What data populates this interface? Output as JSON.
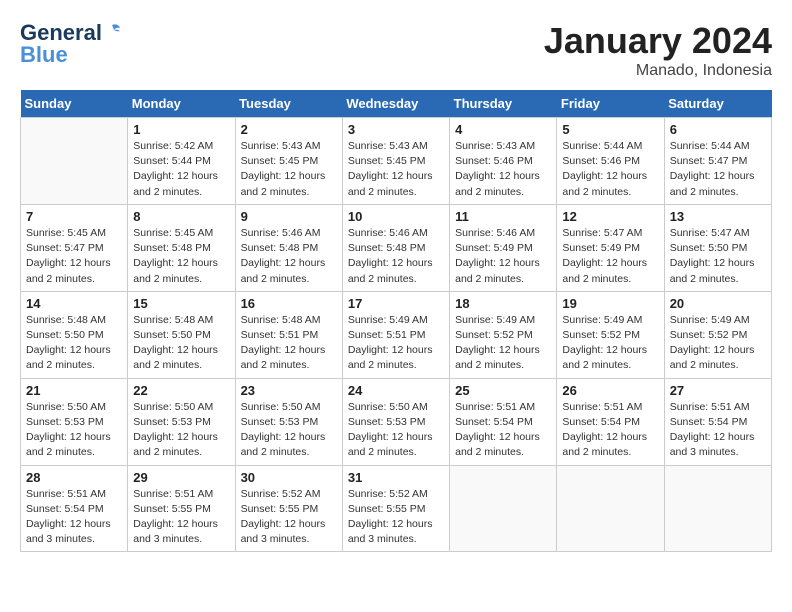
{
  "header": {
    "logo_line1": "General",
    "logo_line2": "Blue",
    "title": "January 2024",
    "subtitle": "Manado, Indonesia"
  },
  "days_of_week": [
    "Sunday",
    "Monday",
    "Tuesday",
    "Wednesday",
    "Thursday",
    "Friday",
    "Saturday"
  ],
  "weeks": [
    [
      {
        "num": "",
        "info": ""
      },
      {
        "num": "1",
        "info": "Sunrise: 5:42 AM\nSunset: 5:44 PM\nDaylight: 12 hours\nand 2 minutes."
      },
      {
        "num": "2",
        "info": "Sunrise: 5:43 AM\nSunset: 5:45 PM\nDaylight: 12 hours\nand 2 minutes."
      },
      {
        "num": "3",
        "info": "Sunrise: 5:43 AM\nSunset: 5:45 PM\nDaylight: 12 hours\nand 2 minutes."
      },
      {
        "num": "4",
        "info": "Sunrise: 5:43 AM\nSunset: 5:46 PM\nDaylight: 12 hours\nand 2 minutes."
      },
      {
        "num": "5",
        "info": "Sunrise: 5:44 AM\nSunset: 5:46 PM\nDaylight: 12 hours\nand 2 minutes."
      },
      {
        "num": "6",
        "info": "Sunrise: 5:44 AM\nSunset: 5:47 PM\nDaylight: 12 hours\nand 2 minutes."
      }
    ],
    [
      {
        "num": "7",
        "info": "Sunrise: 5:45 AM\nSunset: 5:47 PM\nDaylight: 12 hours\nand 2 minutes."
      },
      {
        "num": "8",
        "info": "Sunrise: 5:45 AM\nSunset: 5:48 PM\nDaylight: 12 hours\nand 2 minutes."
      },
      {
        "num": "9",
        "info": "Sunrise: 5:46 AM\nSunset: 5:48 PM\nDaylight: 12 hours\nand 2 minutes."
      },
      {
        "num": "10",
        "info": "Sunrise: 5:46 AM\nSunset: 5:48 PM\nDaylight: 12 hours\nand 2 minutes."
      },
      {
        "num": "11",
        "info": "Sunrise: 5:46 AM\nSunset: 5:49 PM\nDaylight: 12 hours\nand 2 minutes."
      },
      {
        "num": "12",
        "info": "Sunrise: 5:47 AM\nSunset: 5:49 PM\nDaylight: 12 hours\nand 2 minutes."
      },
      {
        "num": "13",
        "info": "Sunrise: 5:47 AM\nSunset: 5:50 PM\nDaylight: 12 hours\nand 2 minutes."
      }
    ],
    [
      {
        "num": "14",
        "info": "Sunrise: 5:48 AM\nSunset: 5:50 PM\nDaylight: 12 hours\nand 2 minutes."
      },
      {
        "num": "15",
        "info": "Sunrise: 5:48 AM\nSunset: 5:50 PM\nDaylight: 12 hours\nand 2 minutes."
      },
      {
        "num": "16",
        "info": "Sunrise: 5:48 AM\nSunset: 5:51 PM\nDaylight: 12 hours\nand 2 minutes."
      },
      {
        "num": "17",
        "info": "Sunrise: 5:49 AM\nSunset: 5:51 PM\nDaylight: 12 hours\nand 2 minutes."
      },
      {
        "num": "18",
        "info": "Sunrise: 5:49 AM\nSunset: 5:52 PM\nDaylight: 12 hours\nand 2 minutes."
      },
      {
        "num": "19",
        "info": "Sunrise: 5:49 AM\nSunset: 5:52 PM\nDaylight: 12 hours\nand 2 minutes."
      },
      {
        "num": "20",
        "info": "Sunrise: 5:49 AM\nSunset: 5:52 PM\nDaylight: 12 hours\nand 2 minutes."
      }
    ],
    [
      {
        "num": "21",
        "info": "Sunrise: 5:50 AM\nSunset: 5:53 PM\nDaylight: 12 hours\nand 2 minutes."
      },
      {
        "num": "22",
        "info": "Sunrise: 5:50 AM\nSunset: 5:53 PM\nDaylight: 12 hours\nand 2 minutes."
      },
      {
        "num": "23",
        "info": "Sunrise: 5:50 AM\nSunset: 5:53 PM\nDaylight: 12 hours\nand 2 minutes."
      },
      {
        "num": "24",
        "info": "Sunrise: 5:50 AM\nSunset: 5:53 PM\nDaylight: 12 hours\nand 2 minutes."
      },
      {
        "num": "25",
        "info": "Sunrise: 5:51 AM\nSunset: 5:54 PM\nDaylight: 12 hours\nand 2 minutes."
      },
      {
        "num": "26",
        "info": "Sunrise: 5:51 AM\nSunset: 5:54 PM\nDaylight: 12 hours\nand 2 minutes."
      },
      {
        "num": "27",
        "info": "Sunrise: 5:51 AM\nSunset: 5:54 PM\nDaylight: 12 hours\nand 3 minutes."
      }
    ],
    [
      {
        "num": "28",
        "info": "Sunrise: 5:51 AM\nSunset: 5:54 PM\nDaylight: 12 hours\nand 3 minutes."
      },
      {
        "num": "29",
        "info": "Sunrise: 5:51 AM\nSunset: 5:55 PM\nDaylight: 12 hours\nand 3 minutes."
      },
      {
        "num": "30",
        "info": "Sunrise: 5:52 AM\nSunset: 5:55 PM\nDaylight: 12 hours\nand 3 minutes."
      },
      {
        "num": "31",
        "info": "Sunrise: 5:52 AM\nSunset: 5:55 PM\nDaylight: 12 hours\nand 3 minutes."
      },
      {
        "num": "",
        "info": ""
      },
      {
        "num": "",
        "info": ""
      },
      {
        "num": "",
        "info": ""
      }
    ]
  ]
}
